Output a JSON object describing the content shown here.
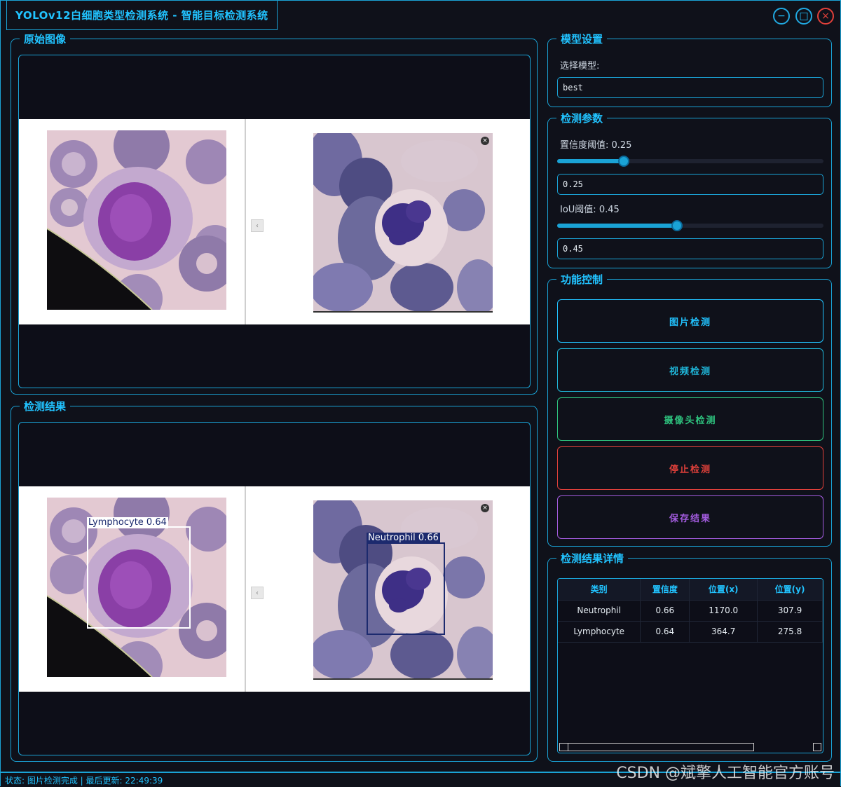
{
  "window": {
    "title": "YOLOv12白细胞类型检测系统 - 智能目标检测系统",
    "min_icon": "−",
    "max_icon": "□",
    "close_icon": "×"
  },
  "original": {
    "title": "原始图像"
  },
  "result": {
    "title": "检测结果",
    "detections": [
      {
        "label": "Lymphocyte 0.64"
      },
      {
        "label": "Neutrophil 0.66"
      }
    ]
  },
  "model": {
    "title": "模型设置",
    "select_label": "选择模型:",
    "selected": "best"
  },
  "params": {
    "title": "检测参数",
    "conf_label": "置信度阈值: 0.25",
    "conf_value": 0.25,
    "conf_input": "0.25",
    "iou_label": "IoU阈值: 0.45",
    "iou_value": 0.45,
    "iou_input": "0.45"
  },
  "controls": {
    "title": "功能控制",
    "image_detect": "图片检测",
    "video_detect": "视频检测",
    "camera_detect": "摄像头检测",
    "stop_detect": "停止检测",
    "save_results": "保存结果"
  },
  "details": {
    "title": "检测结果详情",
    "columns": [
      "类别",
      "置信度",
      "位置(x)",
      "位置(y)"
    ],
    "rows": [
      [
        "Neutrophil",
        "0.66",
        "1170.0",
        "307.9"
      ],
      [
        "Lymphocyte",
        "0.64",
        "364.7",
        "275.8"
      ]
    ]
  },
  "status": {
    "text": "状态: 图片检测完成 | 最后更新: 22:49:39"
  },
  "watermark": "CSDN @斌擎人工智能官方账号",
  "colors": {
    "accent": "#1aa3d6",
    "image_btn": "#21c3ff",
    "video_btn": "#1fb6d9",
    "camera_btn": "#2ec27e",
    "stop_btn": "#e0403a",
    "save_btn": "#a45ce0"
  }
}
